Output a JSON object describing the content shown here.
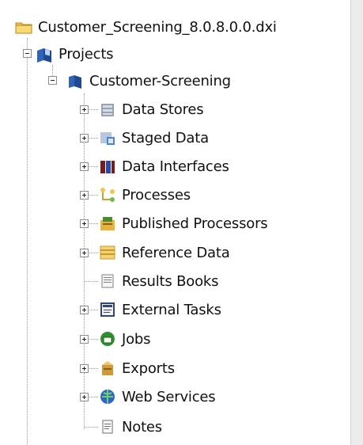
{
  "tree": {
    "root": {
      "label": "Customer_Screening_8.0.8.0.0.dxi",
      "icon": "folder-icon"
    },
    "projects": {
      "label": "Projects",
      "icon": "projects-icon",
      "expanded": true
    },
    "project": {
      "label": "Customer-Screening",
      "icon": "project-icon",
      "expanded": true
    },
    "items": [
      {
        "label": "Data Stores",
        "icon": "data-stores-icon",
        "expandable": true
      },
      {
        "label": "Staged Data",
        "icon": "staged-data-icon",
        "expandable": true
      },
      {
        "label": "Data Interfaces",
        "icon": "data-interfaces-icon",
        "expandable": true
      },
      {
        "label": "Processes",
        "icon": "processes-icon",
        "expandable": true
      },
      {
        "label": "Published Processors",
        "icon": "published-processors-icon",
        "expandable": true
      },
      {
        "label": "Reference Data",
        "icon": "reference-data-icon",
        "expandable": true
      },
      {
        "label": "Results Books",
        "icon": "results-books-icon",
        "expandable": false
      },
      {
        "label": "External Tasks",
        "icon": "external-tasks-icon",
        "expandable": true
      },
      {
        "label": "Jobs",
        "icon": "jobs-icon",
        "expandable": true
      },
      {
        "label": "Exports",
        "icon": "exports-icon",
        "expandable": true
      },
      {
        "label": "Web Services",
        "icon": "web-services-icon",
        "expandable": true
      },
      {
        "label": "Notes",
        "icon": "notes-icon",
        "expandable": false
      }
    ]
  },
  "colors": {
    "folder": "#e8b53a",
    "project_blue": "#2f63b5",
    "text": "#111111"
  }
}
